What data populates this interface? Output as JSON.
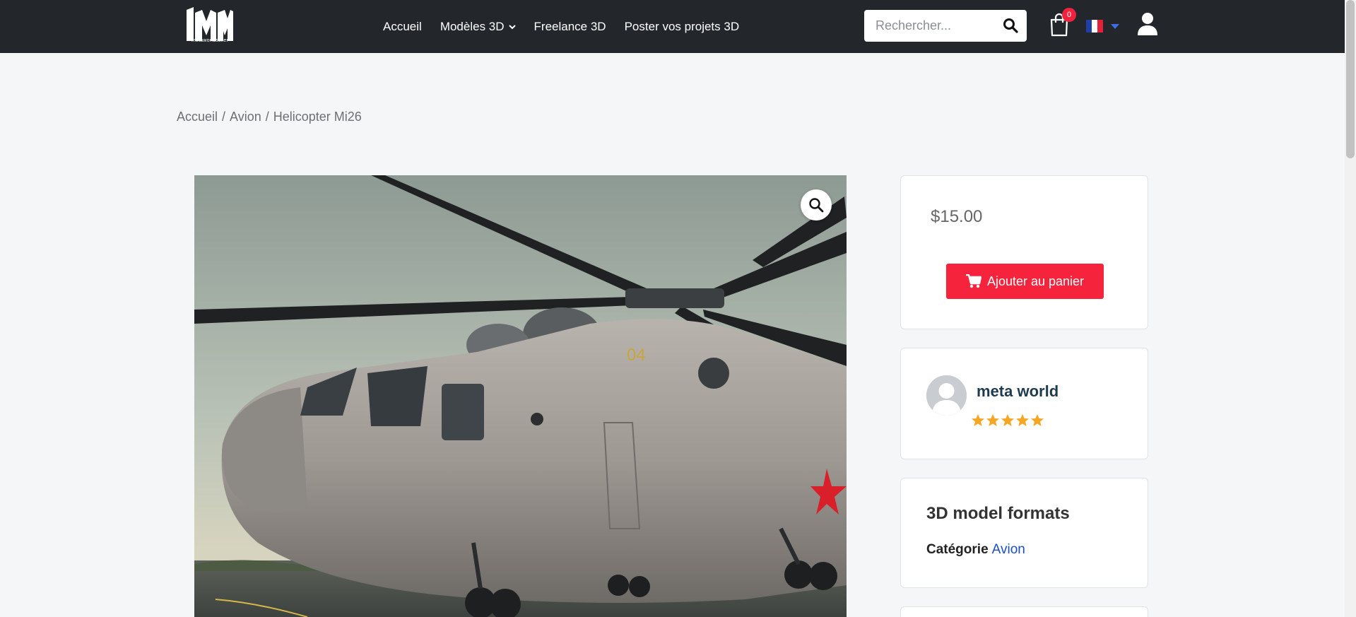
{
  "header": {
    "logo_text": "metaworldseller",
    "nav": [
      {
        "label": "Accueil"
      },
      {
        "label": "Modèles 3D"
      },
      {
        "label": "Freelance 3D"
      },
      {
        "label": "Poster vos projets 3D"
      }
    ],
    "search": {
      "placeholder": "Rechercher..."
    },
    "cart": {
      "count": "0"
    },
    "language": "fr"
  },
  "breadcrumb": {
    "items": [
      "Accueil",
      "Avion",
      "Helicopter Mi26"
    ],
    "separator": "/"
  },
  "product": {
    "image_alt": "Helicopter Mi26",
    "price": "$15.00",
    "add_to_cart_label": "Ajouter au panier"
  },
  "seller": {
    "name": "meta world",
    "rating": 5
  },
  "formats": {
    "title": "3D model formats",
    "category_label": "Catégorie",
    "category_value": "Avion"
  },
  "colors": {
    "header_bg": "#23272c",
    "accent": "#f5233c",
    "star": "#f5a623",
    "link": "#1a4fc4"
  },
  "icons": [
    "logo",
    "chevron-down-icon",
    "search-icon",
    "cart-icon",
    "flag-fr-icon",
    "user-icon",
    "zoom-icon",
    "cart-plus-icon",
    "star-icon"
  ]
}
